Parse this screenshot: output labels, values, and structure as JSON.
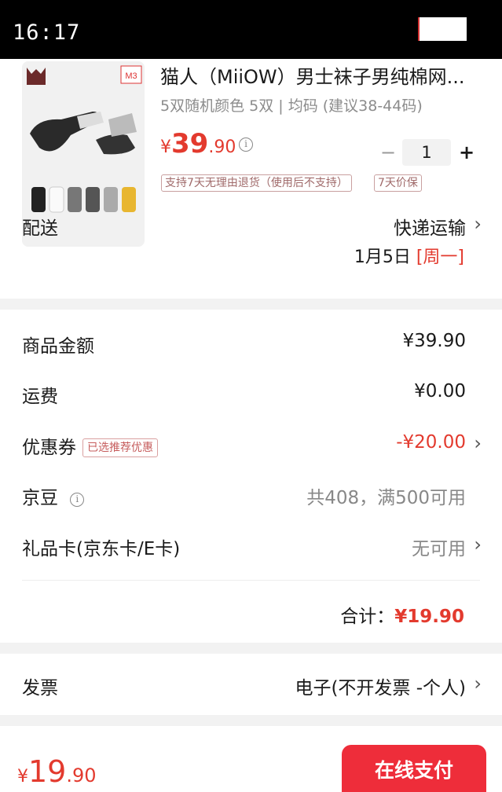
{
  "status_bar": {
    "time": "16:17"
  },
  "product": {
    "title": "猫人（MiiOW）男士袜子男纯棉网...",
    "spec": "5双随机颜色 5双 | 均码 (建议38-44码)",
    "price": {
      "currency": "¥",
      "integer": "39",
      "decimal": ".90"
    },
    "quantity": "1",
    "minus_label": "−",
    "plus_label": "+",
    "thumb_badge": "M3",
    "tags": [
      "支持7天无理由退货（使用后不支持）",
      "7天价保"
    ]
  },
  "delivery": {
    "label": "配送",
    "method": "快递运输",
    "date": "1月5日",
    "weekday": "[周一]"
  },
  "summary": {
    "goods_amount": {
      "label": "商品金额",
      "value": "¥39.90"
    },
    "shipping": {
      "label": "运费",
      "value": "¥0.00"
    },
    "coupon": {
      "label": "优惠券",
      "tag": "已选推荐优惠",
      "value": "-¥20.00"
    },
    "jingdou": {
      "label": "京豆",
      "value": "共408，满500可用"
    },
    "gift_card": {
      "label": "礼品卡(京东卡/E卡)",
      "value": "无可用"
    },
    "total": {
      "label": "合计：",
      "value": "¥19.90"
    }
  },
  "invoice": {
    "label": "发票",
    "value": "电子(不开发票 -个人)"
  },
  "bottom_bar": {
    "price": {
      "currency": "¥",
      "integer": "19",
      "decimal": ".90"
    },
    "pay_label": "在线支付"
  },
  "colors": {
    "accent": "#e33a2e",
    "pay_button": "#ee2d3a"
  },
  "icons": {
    "info": "info-icon",
    "chevron": "chevron-right-icon"
  }
}
